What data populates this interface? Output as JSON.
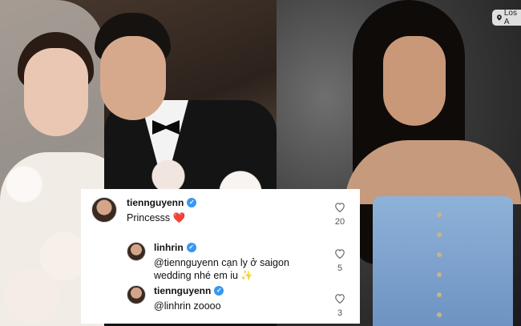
{
  "location": {
    "label": "Los A"
  },
  "comments": [
    {
      "username": "tiennguyenn",
      "text": "Princesss ❤️",
      "likes": "20",
      "verified": true
    },
    {
      "username": "linhrin",
      "text": "@tiennguyenn cạn ly ở saigon wedding nhé em iu ✨",
      "likes": "5",
      "verified": true
    },
    {
      "username": "tiennguyenn",
      "text": "@linhrin zoooo",
      "likes": "3",
      "verified": true
    }
  ]
}
